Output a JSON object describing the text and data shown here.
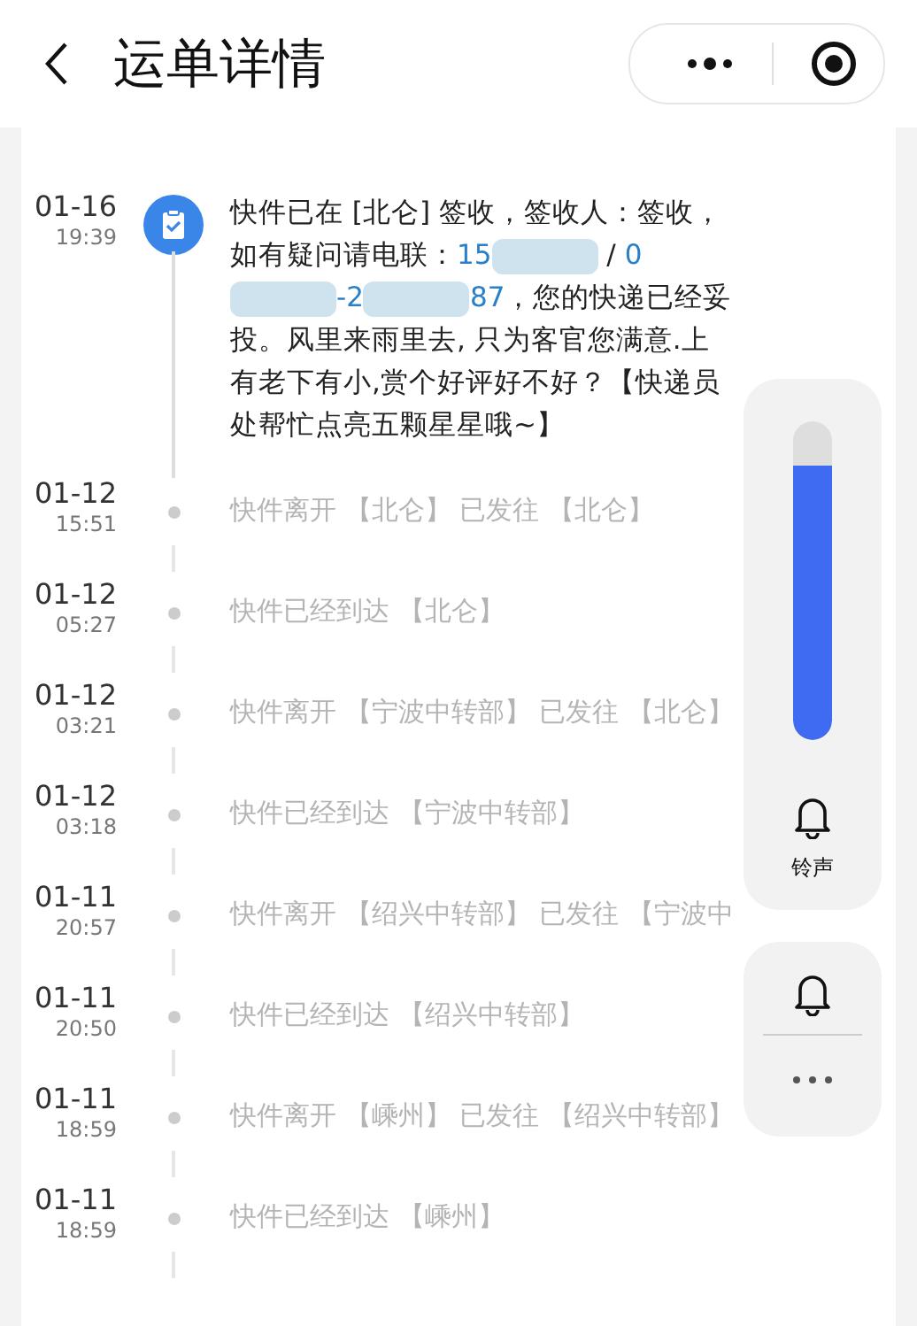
{
  "header": {
    "title": "运单详情"
  },
  "events": [
    {
      "date": "01-16",
      "time": "19:39",
      "kind": "signed",
      "segments": [
        {
          "kind": "text",
          "text": "快件已在 [北仑] 签收，签收人：签收，如有疑问请电联："
        },
        {
          "kind": "link",
          "text": "15"
        },
        {
          "kind": "redacted"
        },
        {
          "kind": "text",
          "text": " / "
        },
        {
          "kind": "link",
          "text": "0"
        },
        {
          "kind": "redacted"
        },
        {
          "kind": "link",
          "text": "-"
        },
        {
          "kind": "link",
          "text": "2"
        },
        {
          "kind": "redacted"
        },
        {
          "kind": "link",
          "text": "87"
        },
        {
          "kind": "text",
          "text": "，您的快递已经妥投。风里来雨里去, 只为客官您满意.上有老下有小,赏个好评好不好？【快递员处帮忙点亮五颗星星哦~】"
        }
      ]
    },
    {
      "date": "01-12",
      "time": "15:51",
      "kind": "transit",
      "segments": [
        {
          "kind": "text",
          "text": "快件离开 【北仑】 已发往 【北仑】"
        }
      ]
    },
    {
      "date": "01-12",
      "time": "05:27",
      "kind": "transit",
      "segments": [
        {
          "kind": "text",
          "text": "快件已经到达 【北仑】"
        }
      ]
    },
    {
      "date": "01-12",
      "time": "03:21",
      "kind": "transit",
      "segments": [
        {
          "kind": "text",
          "text": "快件离开 【宁波中转部】 已发往 【北仑】"
        }
      ]
    },
    {
      "date": "01-12",
      "time": "03:18",
      "kind": "transit",
      "segments": [
        {
          "kind": "text",
          "text": "快件已经到达 【宁波中转部】"
        }
      ]
    },
    {
      "date": "01-11",
      "time": "20:57",
      "kind": "transit",
      "segments": [
        {
          "kind": "text",
          "text": "快件离开 【绍兴中转部】 已发往 【宁波中"
        }
      ]
    },
    {
      "date": "01-11",
      "time": "20:50",
      "kind": "transit",
      "segments": [
        {
          "kind": "text",
          "text": "快件已经到达 【绍兴中转部】"
        }
      ]
    },
    {
      "date": "01-11",
      "time": "18:59",
      "kind": "transit",
      "segments": [
        {
          "kind": "text",
          "text": "快件离开 【嵊州】 已发往 【绍兴中转部】"
        }
      ]
    },
    {
      "date": "01-11",
      "time": "18:59",
      "kind": "transit",
      "segments": [
        {
          "kind": "text",
          "text": "快件已经到达 【嵊州】"
        }
      ]
    }
  ],
  "volume_panel": {
    "level": 0.86,
    "label": "铃声"
  }
}
